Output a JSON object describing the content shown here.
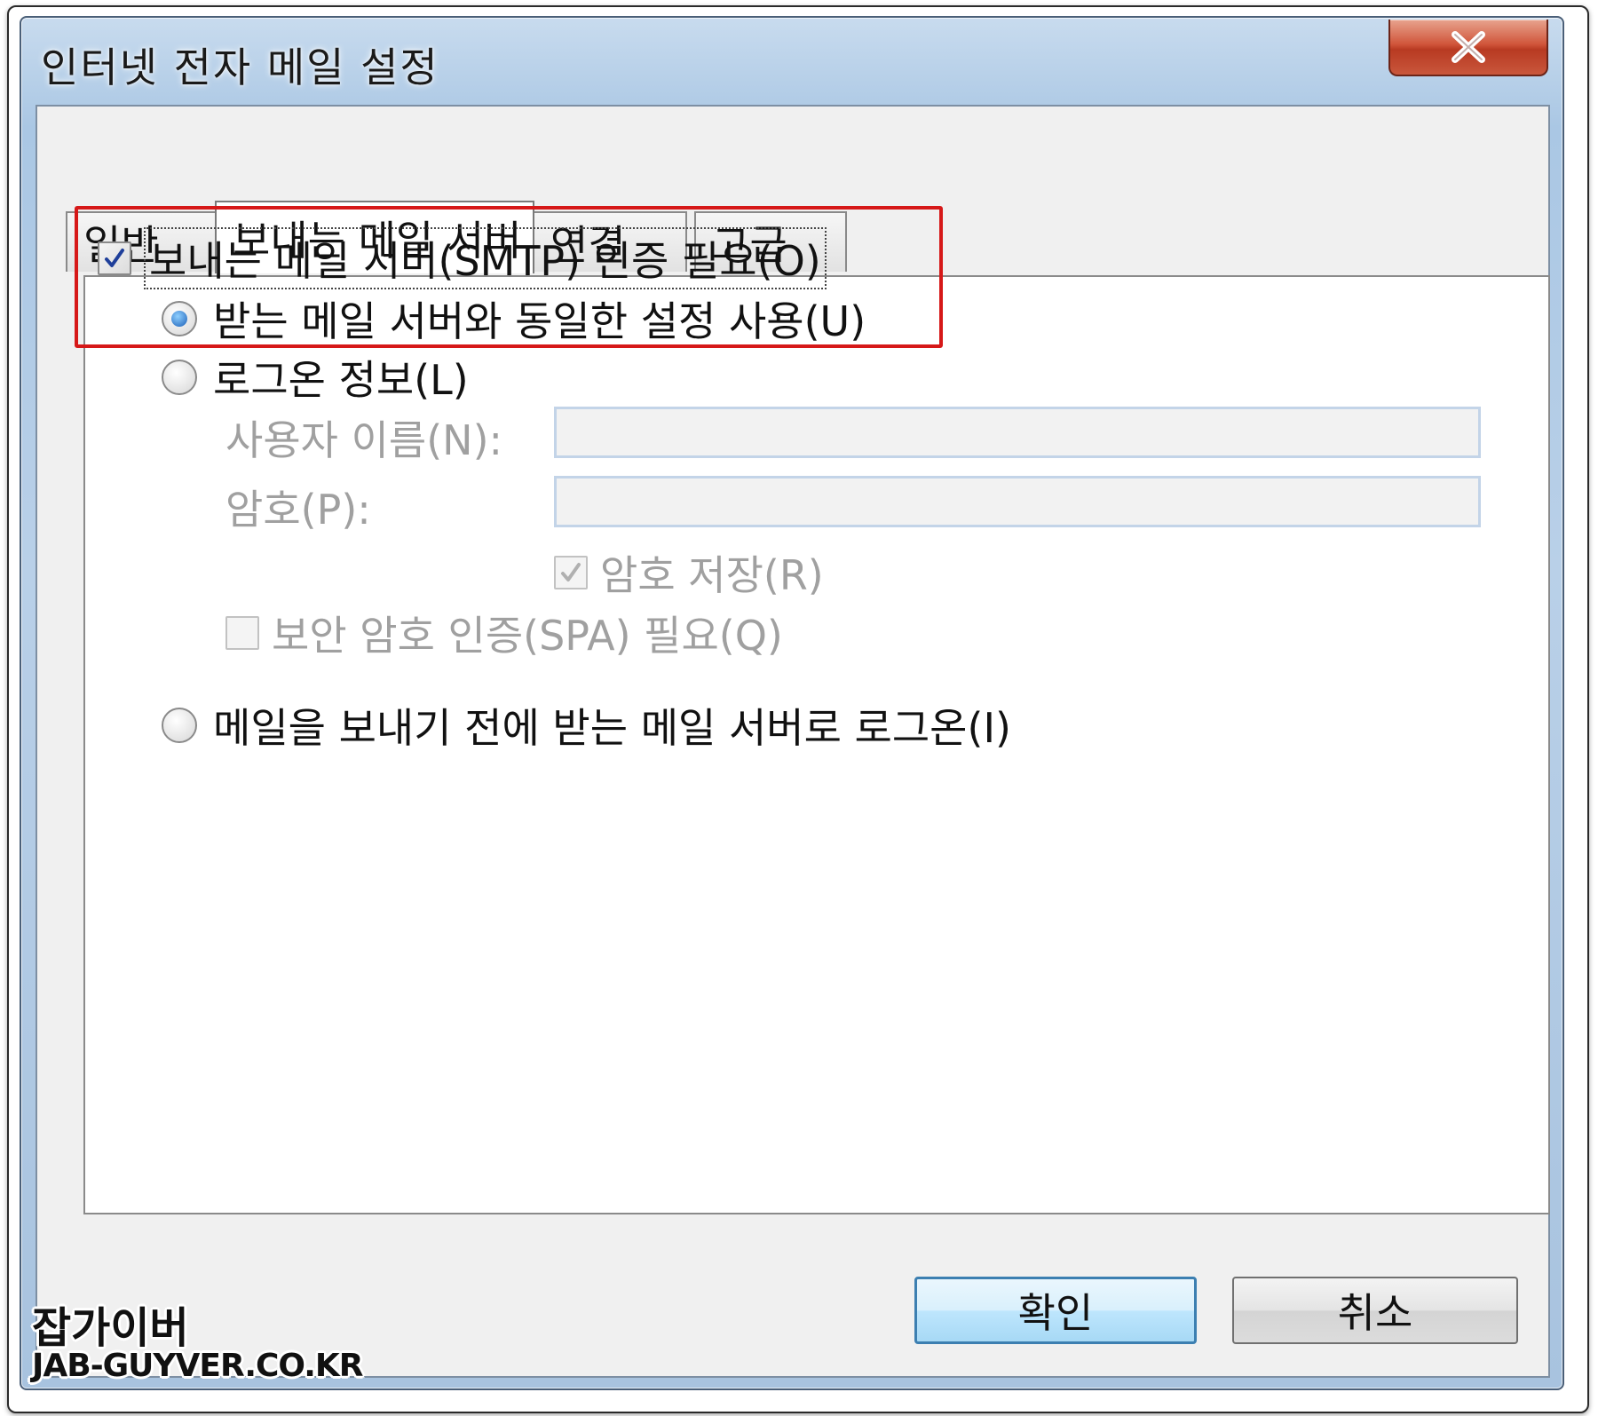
{
  "window": {
    "title": "인터넷 전자 메일 설정",
    "close_symbol": "X"
  },
  "tabs": [
    {
      "label": "일반"
    },
    {
      "label": "보내는 메일 서버"
    },
    {
      "label": "연결"
    },
    {
      "label": "고급"
    }
  ],
  "options": {
    "smtp_auth_label": "보내는 메일 서버(SMTP) 인증 필요(O)",
    "same_as_incoming_label": "받는 메일 서버와 동일한 설정 사용(U)",
    "logon_info_label": "로그온 정보(L)",
    "username_label": "사용자 이름(N):",
    "username_value": "",
    "password_label": "암호(P):",
    "password_value": "",
    "save_password_label": "암호 저장(R)",
    "spa_label": "보안 암호 인증(SPA) 필요(Q)",
    "logon_before_send_label": "메일을 보내기 전에 받는 메일 서버로 로그온(I)"
  },
  "buttons": {
    "ok": "확인",
    "cancel": "취소"
  },
  "watermark": {
    "line1": "잡가이버",
    "line2": "JAB-GUYVER.CO.KR"
  }
}
